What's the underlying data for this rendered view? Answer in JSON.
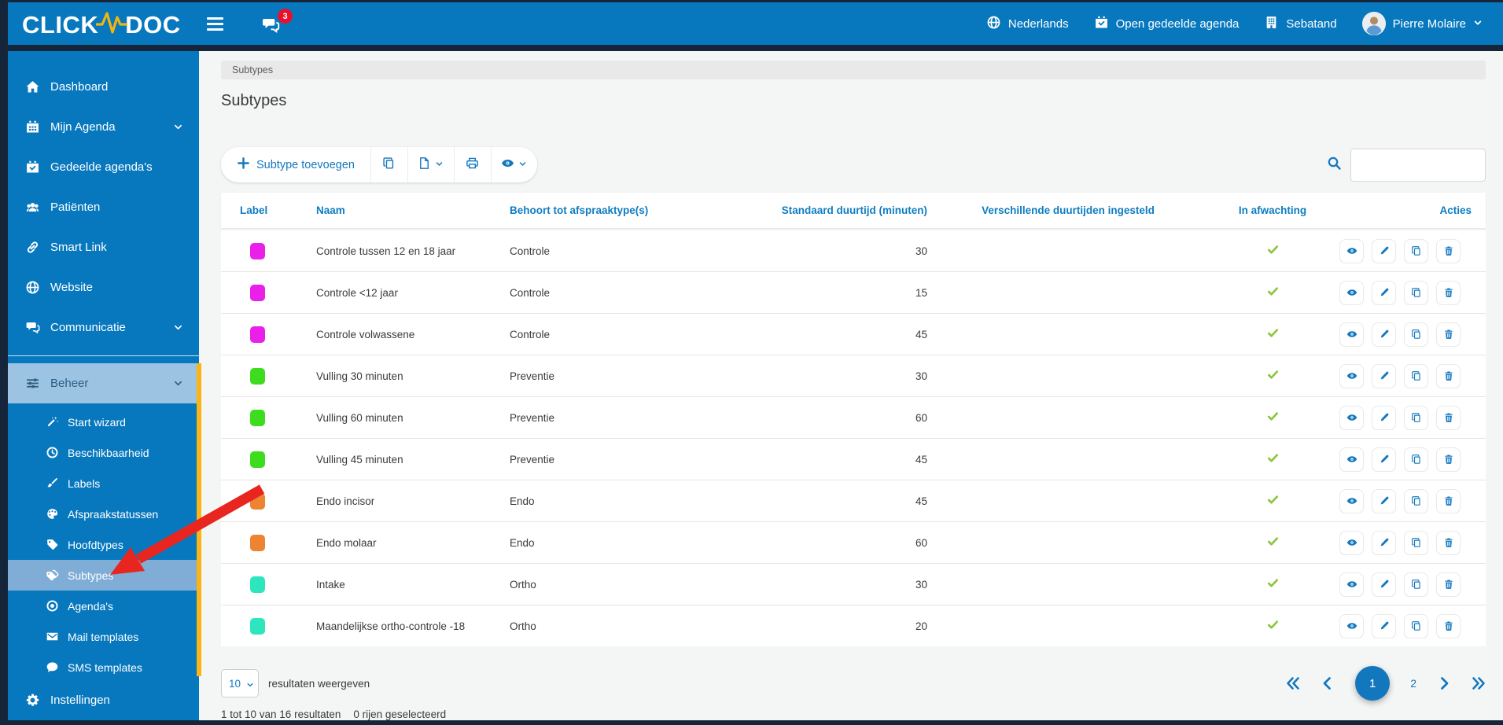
{
  "topbar": {
    "logo_click": "CLICK",
    "logo_doc": "DOC",
    "chat_badge": "3",
    "language_label": "Nederlands",
    "shared_agenda_label": "Open gedeelde agenda",
    "practice_label": "Sebatand",
    "user_label": "Pierre Molaire"
  },
  "sidebar": {
    "items": [
      {
        "label": "Dashboard",
        "icon": "home",
        "chevron": false
      },
      {
        "label": "Mijn Agenda",
        "icon": "calendar",
        "chevron": true
      },
      {
        "label": "Gedeelde agenda's",
        "icon": "calendar-check",
        "chevron": false
      },
      {
        "label": "Patiënten",
        "icon": "users",
        "chevron": false
      },
      {
        "label": "Smart Link",
        "icon": "link",
        "chevron": false
      },
      {
        "label": "Website",
        "icon": "globe",
        "chevron": false
      },
      {
        "label": "Communicatie",
        "icon": "chat",
        "chevron": true
      }
    ],
    "beheer_label": "Beheer",
    "beheer_items": [
      {
        "label": "Start wizard",
        "icon": "wand",
        "selected": false
      },
      {
        "label": "Beschikbaarheid",
        "icon": "clock",
        "selected": false
      },
      {
        "label": "Labels",
        "icon": "brush",
        "selected": false
      },
      {
        "label": "Afspraakstatussen",
        "icon": "palette",
        "selected": false
      },
      {
        "label": "Hoofdtypes",
        "icon": "tag",
        "selected": false
      },
      {
        "label": "Subtypes",
        "icon": "tags",
        "selected": true
      },
      {
        "label": "Agenda's",
        "icon": "target",
        "selected": false
      },
      {
        "label": "Mail templates",
        "icon": "envelope",
        "selected": false
      },
      {
        "label": "SMS templates",
        "icon": "speech",
        "selected": false
      }
    ],
    "settings_label": "Instellingen"
  },
  "breadcrumb": "Subtypes",
  "page_title": "Subtypes",
  "toolbar": {
    "add_label": "Subtype toevoegen"
  },
  "search": {
    "value": ""
  },
  "table": {
    "headers": [
      "Label",
      "Naam",
      "Behoort tot afspraaktype(s)",
      "Standaard duurtijd (minuten)",
      "Verschillende duurtijden ingesteld",
      "In afwachting",
      "Acties"
    ],
    "rows": [
      {
        "color": "#ea1fea",
        "name": "Controle tussen 12 en 18 jaar",
        "type": "Controle",
        "duration": "30",
        "pending": true
      },
      {
        "color": "#ea1fea",
        "name": "Controle <12 jaar",
        "type": "Controle",
        "duration": "15",
        "pending": true
      },
      {
        "color": "#ea1fea",
        "name": "Controle volwassene",
        "type": "Controle",
        "duration": "45",
        "pending": true
      },
      {
        "color": "#3edc1f",
        "name": "Vulling 30 minuten",
        "type": "Preventie",
        "duration": "30",
        "pending": true
      },
      {
        "color": "#3edc1f",
        "name": "Vulling 60 minuten",
        "type": "Preventie",
        "duration": "60",
        "pending": true
      },
      {
        "color": "#3edc1f",
        "name": "Vulling 45 minuten",
        "type": "Preventie",
        "duration": "45",
        "pending": true
      },
      {
        "color": "#ee8432",
        "name": "Endo incisor",
        "type": "Endo",
        "duration": "45",
        "pending": true
      },
      {
        "color": "#ee8432",
        "name": "Endo molaar",
        "type": "Endo",
        "duration": "60",
        "pending": true
      },
      {
        "color": "#2ee6bd",
        "name": "Intake",
        "type": "Ortho",
        "duration": "30",
        "pending": true
      },
      {
        "color": "#2ee6bd",
        "name": "Maandelijkse ortho-controle -18",
        "type": "Ortho",
        "duration": "20",
        "pending": true
      }
    ]
  },
  "footer": {
    "page_size": "10",
    "page_size_label": "resultaten weergeven",
    "results_summary": "1 tot 10 van 16 resultaten",
    "selection_summary": "0 rijen geselecteerd",
    "pages": [
      "1",
      "2"
    ],
    "active_page": "1"
  },
  "colors": {
    "brand_blue": "#0878be",
    "accent_yellow": "#fcb415",
    "link_blue": "#0f7dc2",
    "check_green": "#8cc63e",
    "badge_red": "#e8112d",
    "arrow_red": "#e8251f"
  }
}
